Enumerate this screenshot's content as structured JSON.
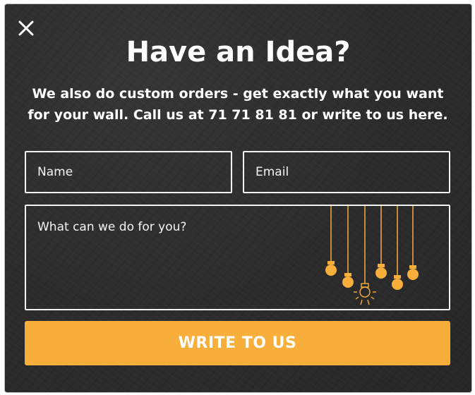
{
  "modal": {
    "close_icon": "close-icon",
    "title": "Have an Idea?",
    "subtitle": "We also do custom orders - get exactly what you want for your wall. Call us at 71 71 81 81 or write to us here."
  },
  "form": {
    "name_placeholder": "Name",
    "email_placeholder": "Email",
    "message_placeholder": "What can we do for you?",
    "submit_label": "WRITE TO US",
    "decoration_icon": "hanging-light-bulbs-icon"
  },
  "colors": {
    "background": "#2e2e2e",
    "accent": "#f7ae3b",
    "border": "#f2f2f2",
    "text": "#ffffff"
  }
}
